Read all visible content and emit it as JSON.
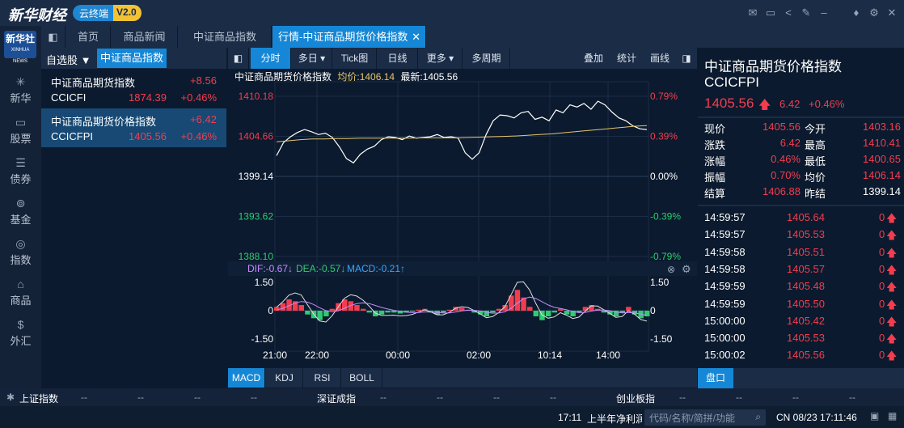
{
  "titlebar": {
    "logo": "新华财经",
    "brand_cloud": "云终端",
    "brand_version": "V2.0",
    "icons": [
      "mail-icon",
      "message-icon",
      "share-icon",
      "edit-icon",
      "minimize-icon",
      "shirt-icon",
      "gear-icon",
      "close-icon"
    ]
  },
  "leftnav": {
    "logo_text": "新华社",
    "logo_sub": "XINHUA NEWS",
    "items": [
      {
        "label": "新华",
        "icon": "xinhua-icon"
      },
      {
        "label": "股票",
        "icon": "stock-icon"
      },
      {
        "label": "债券",
        "icon": "bond-icon"
      },
      {
        "label": "基金",
        "icon": "fund-icon"
      },
      {
        "label": "指数",
        "icon": "index-icon"
      },
      {
        "label": "商品",
        "icon": "commodity-icon"
      },
      {
        "label": "外汇",
        "icon": "forex-icon"
      }
    ]
  },
  "tabs": {
    "items": [
      "首页",
      "商品新闻",
      "中证商品指数",
      "行情-中证商品期货价格指数"
    ],
    "close": "✕"
  },
  "watchlist": {
    "tab_a": "自选股",
    "tab_b": "中证商品指数",
    "rows": [
      {
        "name": "中证商品期货指数",
        "change": "+8.56",
        "code": "CCICFI",
        "price": "1874.39",
        "pct": "+0.46%"
      },
      {
        "name": "中证商品期货价格指数",
        "change": "+6.42",
        "code": "CCICFPI",
        "price": "1405.56",
        "pct": "+0.46%"
      }
    ]
  },
  "chart_toolbar": {
    "items": [
      "分时",
      "多日",
      "Tick图",
      "日线",
      "更多",
      "多周期"
    ],
    "right": [
      "叠加",
      "统计",
      "画线"
    ]
  },
  "chart_info": {
    "name": "中证商品期货价格指数",
    "avg_label": "均价:1406.14",
    "last_label": "最新:1405.56"
  },
  "chart_data": {
    "type": "line",
    "y_ticks_left": [
      "1410.18",
      "1404.66",
      "1399.14",
      "1393.62",
      "1388.10"
    ],
    "y_ticks_right": [
      "0.79%",
      "0.39%",
      "0.00%",
      "-0.39%",
      "-0.79%"
    ],
    "ylim": [
      1388.1,
      1410.18
    ],
    "x_ticks": [
      "21:00",
      "22:00",
      "00:00",
      "02:00",
      "10:14",
      "14:00"
    ],
    "series": [
      {
        "values": [
          1402.0,
          1403.8,
          1404.6,
          1405.2,
          1405.6,
          1405.3,
          1404.9,
          1405.1,
          1404.5,
          1403.2,
          1401.6,
          1401.0,
          1402.2,
          1402.9,
          1403.3,
          1404.2,
          1404.6,
          1404.5,
          1404.2,
          1404.7,
          1404.4,
          1404.5,
          1404.6,
          1404.9,
          1404.5,
          1404.6,
          1404.4,
          1402.4,
          1401.5,
          1402.4,
          1404.9,
          1406.8,
          1407.6,
          1407.5,
          1407.2,
          1407.9,
          1408.1,
          1407.0,
          1407.3,
          1406.8,
          1408.3,
          1407.9,
          1409.0,
          1408.7,
          1409.2,
          1408.4,
          1409.5,
          1409.0,
          1408.0,
          1407.2,
          1406.8,
          1406.1,
          1405.7,
          1405.6
        ]
      },
      {
        "values": [
          1403.9,
          1404.05,
          1404.2,
          1404.3,
          1404.3,
          1404.35,
          1404.35,
          1404.4,
          1404.4,
          1404.4,
          1404.4,
          1404.4,
          1404.45,
          1404.45,
          1404.45,
          1404.45,
          1404.5,
          1404.55,
          1404.6,
          1404.65,
          1404.7,
          1404.8,
          1404.9,
          1405.0,
          1405.15,
          1405.3,
          1405.45,
          1405.6,
          1405.75,
          1405.9,
          1406.05,
          1406.14
        ]
      }
    ]
  },
  "macd": {
    "dif": "DIF:-0.67↓",
    "dea": "DEA:-0.57↓",
    "macd": "MACD:-0.21↑",
    "y_ticks": [
      "1.50",
      "0",
      "-1.50"
    ],
    "bars": [
      0.2,
      0.4,
      0.6,
      0.5,
      0.3,
      -0.2,
      -0.4,
      -0.5,
      -0.3,
      0.1,
      0.4,
      0.6,
      0.5,
      0.3,
      0.1,
      -0.1,
      -0.3,
      -0.2,
      -0.1,
      -0.1,
      -0.15,
      -0.1,
      -0.05,
      0.05,
      0.1,
      -0.1,
      -0.2,
      -0.1,
      0.05,
      0.2,
      0.15,
      0.05,
      -0.1,
      -0.2,
      -0.3,
      -0.1,
      0.1,
      0.3,
      0.8,
      1.1,
      0.7,
      0.2,
      -0.3,
      -0.5,
      -0.3,
      -0.1,
      0.1,
      -0.2,
      -0.3,
      -0.1,
      0.2,
      0.3,
      0.1,
      -0.1,
      -0.2,
      -0.3,
      -0.1,
      0.2,
      -0.2,
      -0.4,
      -0.3
    ]
  },
  "bottom_tabs": [
    "MACD",
    "KDJ",
    "RSI",
    "BOLL"
  ],
  "quote": {
    "name": "中证商品期货价格指数",
    "code": "CCICFPI",
    "price": "1405.56",
    "change": "6.42",
    "pct": "+0.46%",
    "fields": [
      {
        "l1": "现价",
        "v1": "1405.56",
        "l2": "今开",
        "v2": "1403.16"
      },
      {
        "l1": "涨跌",
        "v1": "6.42",
        "l2": "最高",
        "v2": "1410.41"
      },
      {
        "l1": "涨幅",
        "v1": "0.46%",
        "l2": "最低",
        "v2": "1400.65"
      },
      {
        "l1": "振幅",
        "v1": "0.70%",
        "l2": "均价",
        "v2": "1406.14"
      },
      {
        "l1": "结算",
        "v1": "1406.88",
        "l2": "昨结",
        "v2": "1399.14"
      }
    ],
    "ticks": [
      {
        "t": "14:59:57",
        "p": "1405.64",
        "v": "0"
      },
      {
        "t": "14:59:57",
        "p": "1405.53",
        "v": "0"
      },
      {
        "t": "14:59:58",
        "p": "1405.51",
        "v": "0"
      },
      {
        "t": "14:59:58",
        "p": "1405.57",
        "v": "0"
      },
      {
        "t": "14:59:59",
        "p": "1405.48",
        "v": "0"
      },
      {
        "t": "14:59:59",
        "p": "1405.50",
        "v": "0"
      },
      {
        "t": "15:00:00",
        "p": "1405.42",
        "v": "0"
      },
      {
        "t": "15:00:00",
        "p": "1405.53",
        "v": "0"
      },
      {
        "t": "15:00:02",
        "p": "1405.56",
        "v": "0"
      }
    ],
    "pankou": "盘口"
  },
  "status": {
    "a_label": "上证指数",
    "b_label": "深证成指",
    "c_label": "创业板指",
    "dash": "--"
  },
  "bottom": {
    "time": "17:11",
    "news": "上半年净利润",
    "search_placeholder": "代码/名称/简拼/功能",
    "datetime": "CN 08/23 17:11:46"
  },
  "colors": {
    "up": "#f23d4f",
    "down": "#2ecc71",
    "accent": "#1587d6",
    "avg": "#e7c66c"
  }
}
